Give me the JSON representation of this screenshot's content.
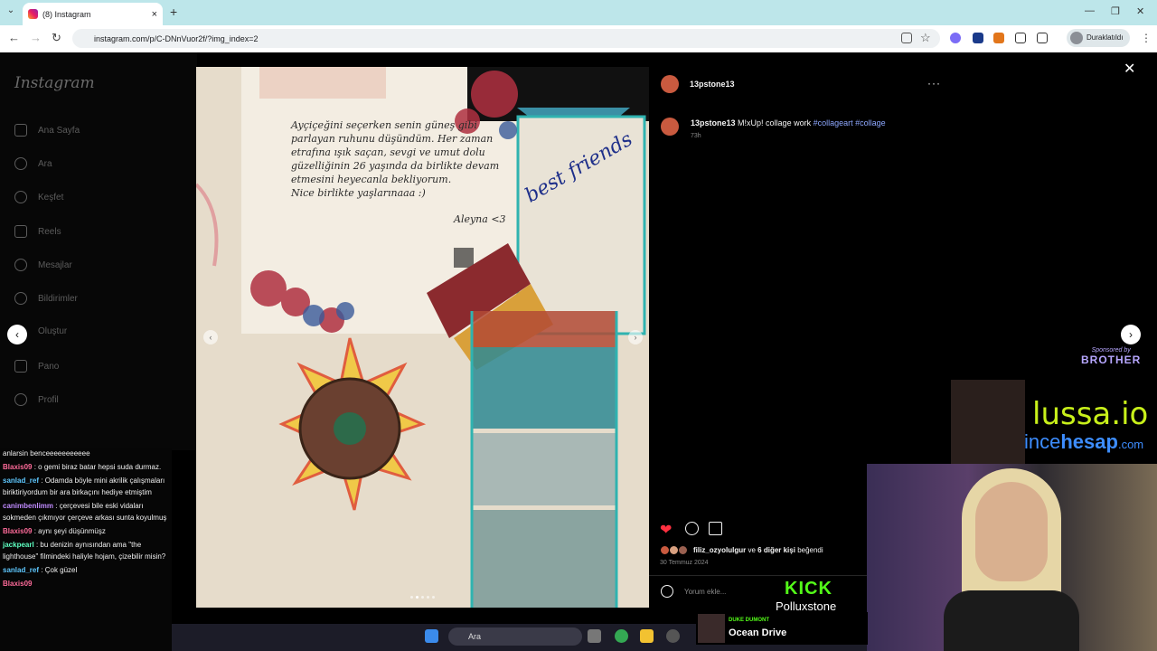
{
  "browser": {
    "tab_title": "(8) Instagram",
    "url": "instagram.com/p/C-DNnVuor2f/?img_index=2",
    "profile_label": "Duraklatıldı"
  },
  "sidebar": {
    "logo": "Instagram",
    "items": [
      {
        "label": "Ana Sayfa",
        "icon": "home-icon"
      },
      {
        "label": "Ara",
        "icon": "search-icon"
      },
      {
        "label": "Keşfet",
        "icon": "compass-icon"
      },
      {
        "label": "Reels",
        "icon": "reels-icon"
      },
      {
        "label": "Mesajlar",
        "icon": "messenger-icon"
      },
      {
        "label": "Bildirimler",
        "icon": "heart-icon"
      },
      {
        "label": "Oluştur",
        "icon": "plus-icon"
      },
      {
        "label": "Pano",
        "icon": "dashboard-icon"
      },
      {
        "label": "Profil",
        "icon": "avatar-icon"
      }
    ]
  },
  "post": {
    "username": "13pstone13",
    "caption_user": "13pstone13",
    "caption_text": "M!xUp! collage work",
    "hashtags": [
      "#collageart",
      "#collage"
    ],
    "time_ago": "73h",
    "likes_user": "filiz_ozyolulgur",
    "likes_mid": "ve",
    "likes_others": "6 diğer kişi",
    "likes_suffix": "beğendi",
    "date": "30 Temmuz 2024",
    "comment_placeholder": "Yorum ekle...",
    "image_note_lines": [
      "Ayçiçeğini seçerken senin güneş gibi",
      "parlayan ruhunu düşündüm. Her zaman",
      "etrafına ışık saçan, sevgi ve umut dolu",
      "güzelliğinin 26 yaşında da birlikte devam",
      "etmesini heyecanla bekliyorum.",
      "Nice birlikte yaşlarınaaa :)"
    ],
    "image_note_sign": "Aleyna <3",
    "image_handwriting": "best friends"
  },
  "chat": [
    {
      "user": "",
      "text": "anlarsin benceeeeeeeeeee",
      "color": "#ffffff"
    },
    {
      "user": "Blaxis09",
      "text": ": o gemi biraz batar hepsi suda durmaz.",
      "color": "#ff6b9a"
    },
    {
      "user": "sanlad_ref",
      "text": ": Odamda böyle mini akrilik çalışmaları biriktiriyordum bir ara birkaçını hediye etmiştim",
      "color": "#5ec8ff"
    },
    {
      "user": "canimbenlimm",
      "text": ": çerçevesi bile eski vidaları sokmeden çıkmıyor çerçeve arkası sunta koyulmuş",
      "color": "#c08bff"
    },
    {
      "user": "Blaxis09",
      "text": ": aynı şeyi düşünmüşz",
      "color": "#ff6b9a"
    },
    {
      "user": "jackpearl",
      "text": ": bu denizin aynısından ama \"the lighthouse\" filmindeki haliyle hojam, çizebilir misin?",
      "color": "#5effc1"
    },
    {
      "user": "sanlad_ref",
      "text": ": Çok güzel",
      "color": "#5ec8ff"
    },
    {
      "user": "Blaxis09",
      "text": "",
      "color": "#ff6b9a"
    }
  ],
  "taskbar": {
    "search_label": "Ara"
  },
  "overlay": {
    "sponsored_by": "Sponsored by",
    "sponsor_name": "BROTHER",
    "lussa": "lussa.io",
    "incehesap_thin": "ince",
    "incehesap_bold": "hesap",
    "incehesap_tld": ".com",
    "kick_logo": "KICK",
    "kick_name": "Polluxstone",
    "music_artist": "DUKE DUMONT",
    "music_title": "Ocean Drive"
  }
}
